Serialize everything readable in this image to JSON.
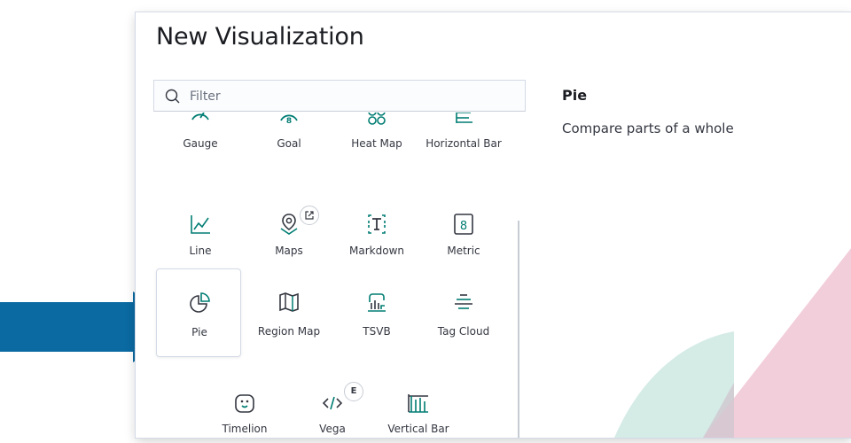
{
  "modal": {
    "title": "New Visualization"
  },
  "filter": {
    "placeholder": "Filter",
    "value": ""
  },
  "visualizations": [
    {
      "label": "Gauge",
      "icon": "gauge-icon"
    },
    {
      "label": "Goal",
      "icon": "goal-icon"
    },
    {
      "label": "Heat Map",
      "icon": "heat-map-icon"
    },
    {
      "label": "Horizontal Bar",
      "icon": "horizontal-bar-icon"
    },
    {
      "label": "Line",
      "icon": "line-chart-icon"
    },
    {
      "label": "Maps",
      "icon": "map-pin-icon",
      "badge_icon": "external-link-icon"
    },
    {
      "label": "Markdown",
      "icon": "markdown-icon"
    },
    {
      "label": "Metric",
      "icon": "metric-icon"
    },
    {
      "label": "Pie",
      "icon": "pie-chart-icon",
      "selected": true
    },
    {
      "label": "Region Map",
      "icon": "region-map-icon"
    },
    {
      "label": "TSVB",
      "icon": "tsvb-icon"
    },
    {
      "label": "Tag Cloud",
      "icon": "tag-cloud-icon"
    },
    {
      "label": "Timelion",
      "icon": "timelion-icon"
    },
    {
      "label": "Vega",
      "icon": "vega-code-icon",
      "badge": "E"
    },
    {
      "label": "Vertical Bar",
      "icon": "vertical-bar-icon"
    }
  ],
  "description": {
    "title": "Pie",
    "text": "Compare parts of a whole"
  },
  "colors": {
    "accent": "#017d73",
    "arrow": "#0b6aa2",
    "decor_pink": "#f2cdda",
    "decor_teal": "#d5ebe6"
  }
}
